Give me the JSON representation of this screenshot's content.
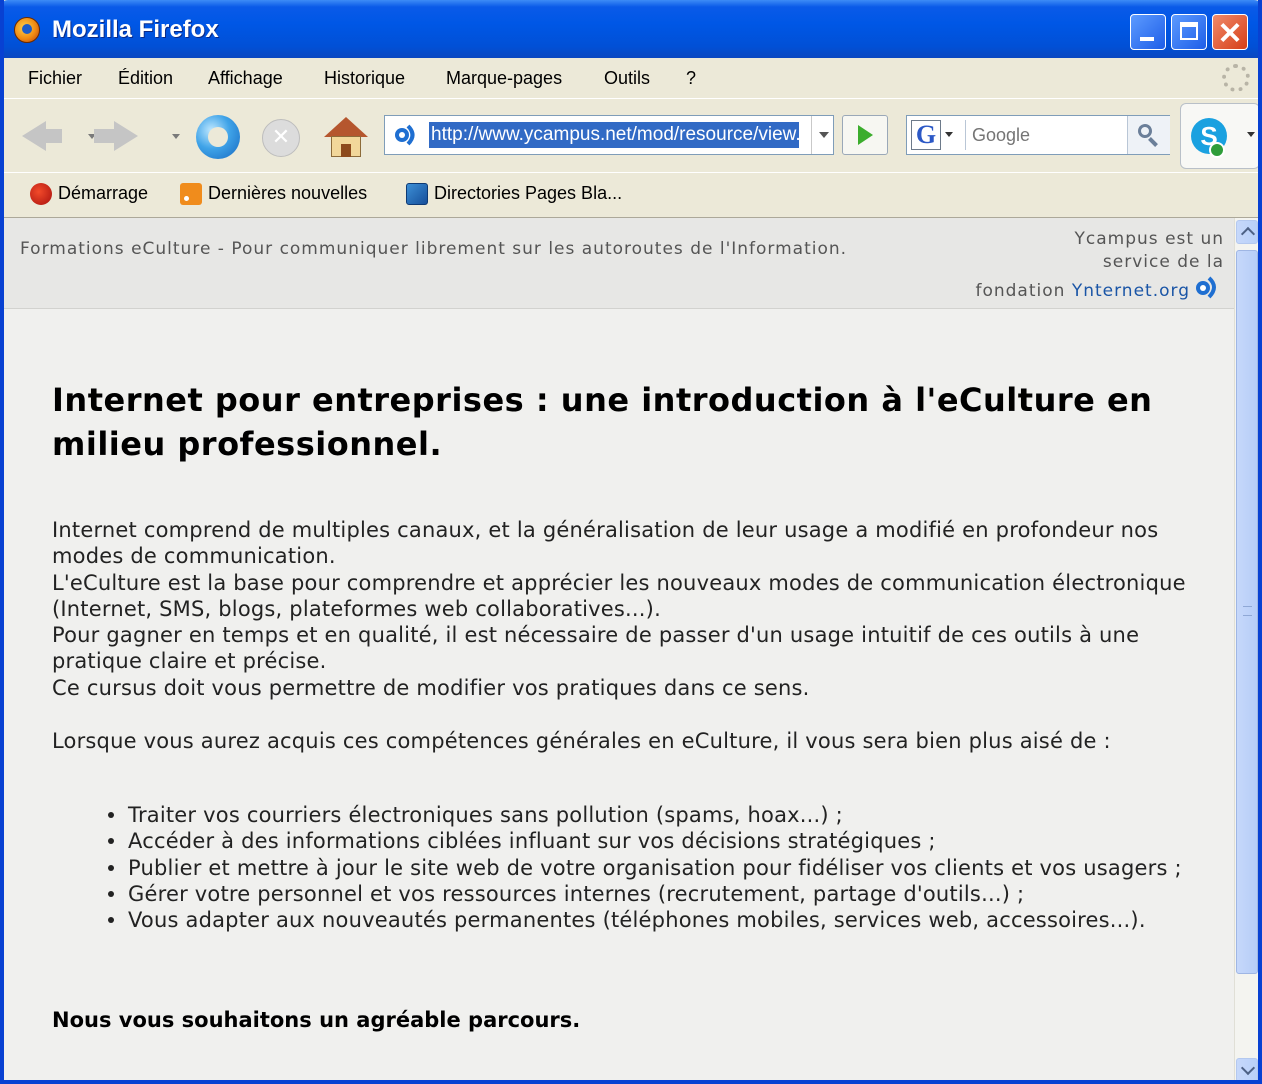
{
  "window": {
    "title": "Mozilla Firefox"
  },
  "menu": {
    "items": [
      {
        "label": "Fichier"
      },
      {
        "label": "Édition"
      },
      {
        "label": "Affichage"
      },
      {
        "label": "Historique"
      },
      {
        "label": "Marque-pages"
      },
      {
        "label": "Outils"
      },
      {
        "label": "?"
      }
    ]
  },
  "nav": {
    "url": "http://www.ycampus.net/mod/resource/view.php",
    "search_placeholder": "Google"
  },
  "bookmarks": {
    "items": [
      {
        "label": "Démarrage",
        "icon": "firefox-start-icon"
      },
      {
        "label": "Dernières nouvelles",
        "icon": "rss-feed-icon"
      },
      {
        "label": "Directories Pages Bla...",
        "icon": "directory-icon"
      }
    ]
  },
  "page": {
    "tagline": "Formations eCulture - Pour communiquer librement sur les autoroutes de l'Information.",
    "host_line1": "Ycampus est un service de la",
    "host_line2_prefix": "fondation",
    "host_link": "Ynternet.org",
    "title": "Internet pour entreprises : une introduction à l'eCulture en milieu professionnel.",
    "paragraphs": [
      "Internet comprend de multiples canaux, et la généralisation de leur usage a modifié en profondeur nos modes de communication.",
      "L'eCulture est la base pour comprendre et apprécier les nouveaux modes de communication électronique (Internet, SMS, blogs, plateformes web collaboratives...).",
      "Pour gagner en temps et en qualité, il est nécessaire de passer d'un usage intuitif de ces outils à une pratique claire et précise.",
      "Ce cursus doit vous permettre de modifier vos pratiques dans ce sens."
    ],
    "intro_list": "Lorsque vous aurez acquis ces compétences générales en eCulture, il vous sera bien plus aisé de :",
    "bullets": [
      "Traiter vos courriers électroniques sans pollution (spams, hoax...) ;",
      "Accéder à des informations ciblées influant sur vos décisions stratégiques ;",
      "Publier et mettre à jour le site web de votre organisation pour fidéliser vos clients et vos usagers ;",
      "Gérer votre personnel et vos ressources internes (recrutement, partage d'outils...) ;",
      "Vous adapter aux nouveautés permanentes (téléphones mobiles, services web, accessoires...)."
    ],
    "closing": "Nous vous souhaitons un agréable parcours."
  },
  "colors": {
    "titlebar": "#0057e6",
    "url_selection": "#316ac5",
    "link": "#1a55a6",
    "scrollbar": "#c6d8fb"
  }
}
